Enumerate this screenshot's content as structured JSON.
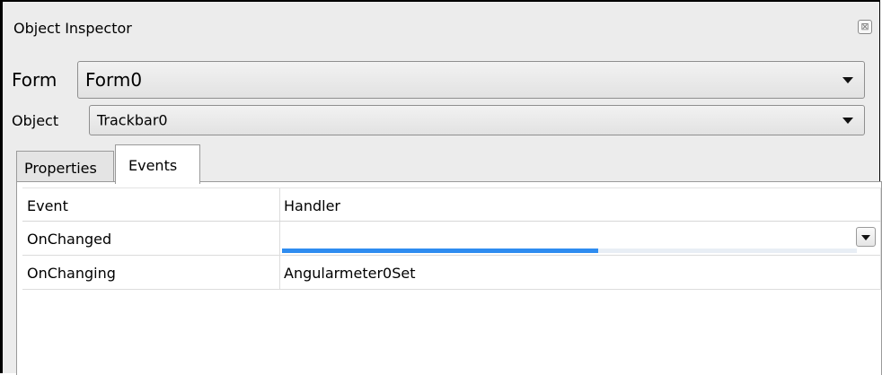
{
  "window": {
    "title": "Object Inspector",
    "close_glyph": "⊠"
  },
  "form_selector": {
    "label": "Form",
    "value": "Form0"
  },
  "object_selector": {
    "label": "Object",
    "value": "Trackbar0"
  },
  "tabs": [
    {
      "label": "Properties",
      "active": false
    },
    {
      "label": "Events",
      "active": true
    }
  ],
  "events_table": {
    "columns": [
      "Event",
      "Handler"
    ],
    "rows": [
      {
        "event": "OnChanged",
        "handler": "",
        "editing": true,
        "progress": 0.55
      },
      {
        "event": "OnChanging",
        "handler": "Angularmeter0Set"
      }
    ]
  },
  "colors": {
    "progress": "#2e8cf0",
    "panel_bg": "#ececec"
  }
}
